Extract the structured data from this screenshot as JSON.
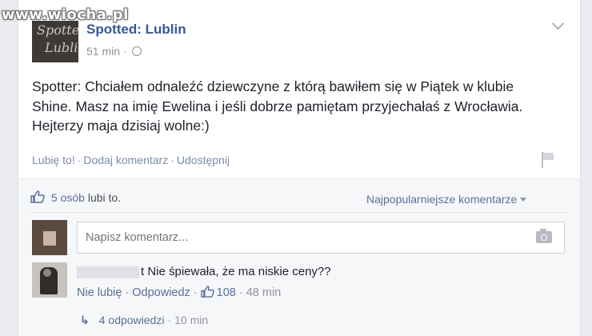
{
  "watermark": "www.wiocha.pl",
  "post": {
    "page_name": "Spotted: Lublin",
    "avatar_text": "Lublin",
    "time": "51 min",
    "text": "Spotter: Chciałem odnaleźć dziewczyne z którą bawiłem się w Piątek w klubie Shine. Masz na imię Ewelina i jeśli dobrze pamiętam przyjechałaś z Wrocławia. Hejterzy maja dzisiaj wolne:)",
    "actions": {
      "like": "Lubię to!",
      "comment": "Dodaj komentarz",
      "share": "Udostępnij"
    }
  },
  "likes": {
    "count_text": "5 osób",
    "suffix": "lubi to."
  },
  "sort_label": "Najpopularniejsze komentarze",
  "comment_box": {
    "placeholder": "Napisz komentarz..."
  },
  "comment": {
    "text": "t Nie śpiewała, że ma niskie ceny??",
    "unlike": "Nie lubię",
    "reply": "Odpowiedz",
    "like_count": "108",
    "time": "48 min"
  },
  "replies": {
    "label": "4 odpowiedzi",
    "time": "10 min"
  },
  "colors": {
    "link": "#365899",
    "background": "#e9ebee"
  },
  "icons": [
    "globe-icon",
    "chevron-down-icon",
    "flag-icon",
    "thumbs-up-icon",
    "camera-icon",
    "reply-arrow-icon"
  ]
}
